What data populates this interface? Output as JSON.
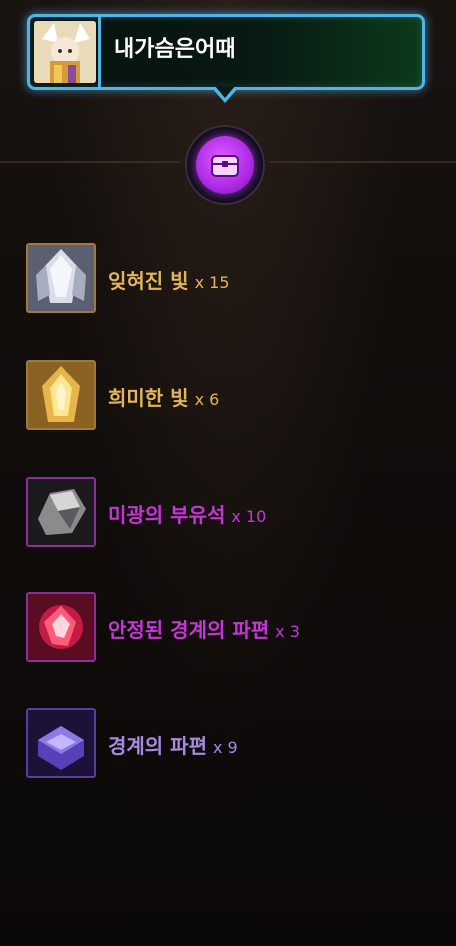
{
  "player": {
    "name": "내가슴은어때"
  },
  "rewards": [
    {
      "name": "잊혀진 빛",
      "quantity": "x 15",
      "color": "#e2b55a",
      "icon": "forgotten-light-icon"
    },
    {
      "name": "희미한 빛",
      "quantity": "x 6",
      "color": "#e2b55a",
      "icon": "faint-light-icon"
    },
    {
      "name": "미광의 부유석",
      "quantity": "x 10",
      "color": "#c437d6",
      "icon": "floating-stone-icon"
    },
    {
      "name": "안정된 경계의 파편",
      "quantity": "x 3",
      "color": "#c437d6",
      "icon": "stable-boundary-shard-icon"
    },
    {
      "name": "경계의 파편",
      "quantity": "x 9",
      "color": "#a789e3",
      "icon": "boundary-shard-icon"
    }
  ]
}
